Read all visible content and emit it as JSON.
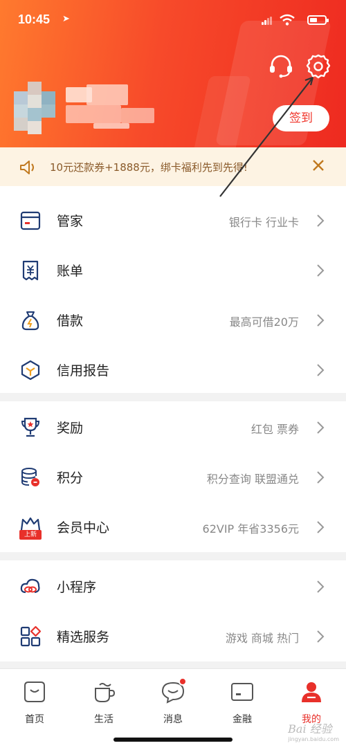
{
  "status_bar": {
    "time": "10:45",
    "location_icon": "location-arrow-icon",
    "signal_icon": "signal-icon",
    "wifi_icon": "wifi-icon",
    "battery_icon": "battery-icon"
  },
  "header": {
    "customer_service_icon": "headset-icon",
    "settings_icon": "gear-icon",
    "signin_label": "签到"
  },
  "notice": {
    "text": "10元还款券+1888元，绑卡福利先到先得!",
    "icon": "speaker-icon",
    "close_icon": "close-icon"
  },
  "menu": [
    {
      "label": "管家",
      "hint": "银行卡 行业卡",
      "icon": "card-icon"
    },
    {
      "label": "账单",
      "hint": "",
      "icon": "bill-icon"
    },
    {
      "label": "借款",
      "hint": "最高可借20万",
      "icon": "money-bag-icon"
    },
    {
      "label": "信用报告",
      "hint": "",
      "icon": "cube-icon"
    },
    {
      "label": "奖励",
      "hint": "红包 票券",
      "icon": "trophy-icon"
    },
    {
      "label": "积分",
      "hint": "积分查询 联盟通兑",
      "icon": "coins-icon"
    },
    {
      "label": "会员中心",
      "hint": "62VIP 年省3356元",
      "icon": "crown-icon",
      "badge": "上新"
    },
    {
      "label": "小程序",
      "hint": "",
      "icon": "cloud-link-icon"
    },
    {
      "label": "精选服务",
      "hint": "游戏 商城 热门",
      "icon": "grid-apps-icon"
    }
  ],
  "tabs": [
    {
      "label": "首页",
      "icon": "home-face-icon"
    },
    {
      "label": "生活",
      "icon": "cup-icon"
    },
    {
      "label": "消息",
      "icon": "chat-bubble-icon"
    },
    {
      "label": "金融",
      "icon": "finance-card-icon"
    },
    {
      "label": "我的",
      "icon": "person-icon",
      "active": true
    }
  ],
  "watermark": {
    "line1": "Bai 经验",
    "line2": "jingyan.baidu.com"
  },
  "colors": {
    "accent": "#e8302a",
    "header_start": "#ff7a2e",
    "header_end": "#ee2a20",
    "notice_bg": "#fdf3e3",
    "icon_blue": "#1f3b73"
  }
}
